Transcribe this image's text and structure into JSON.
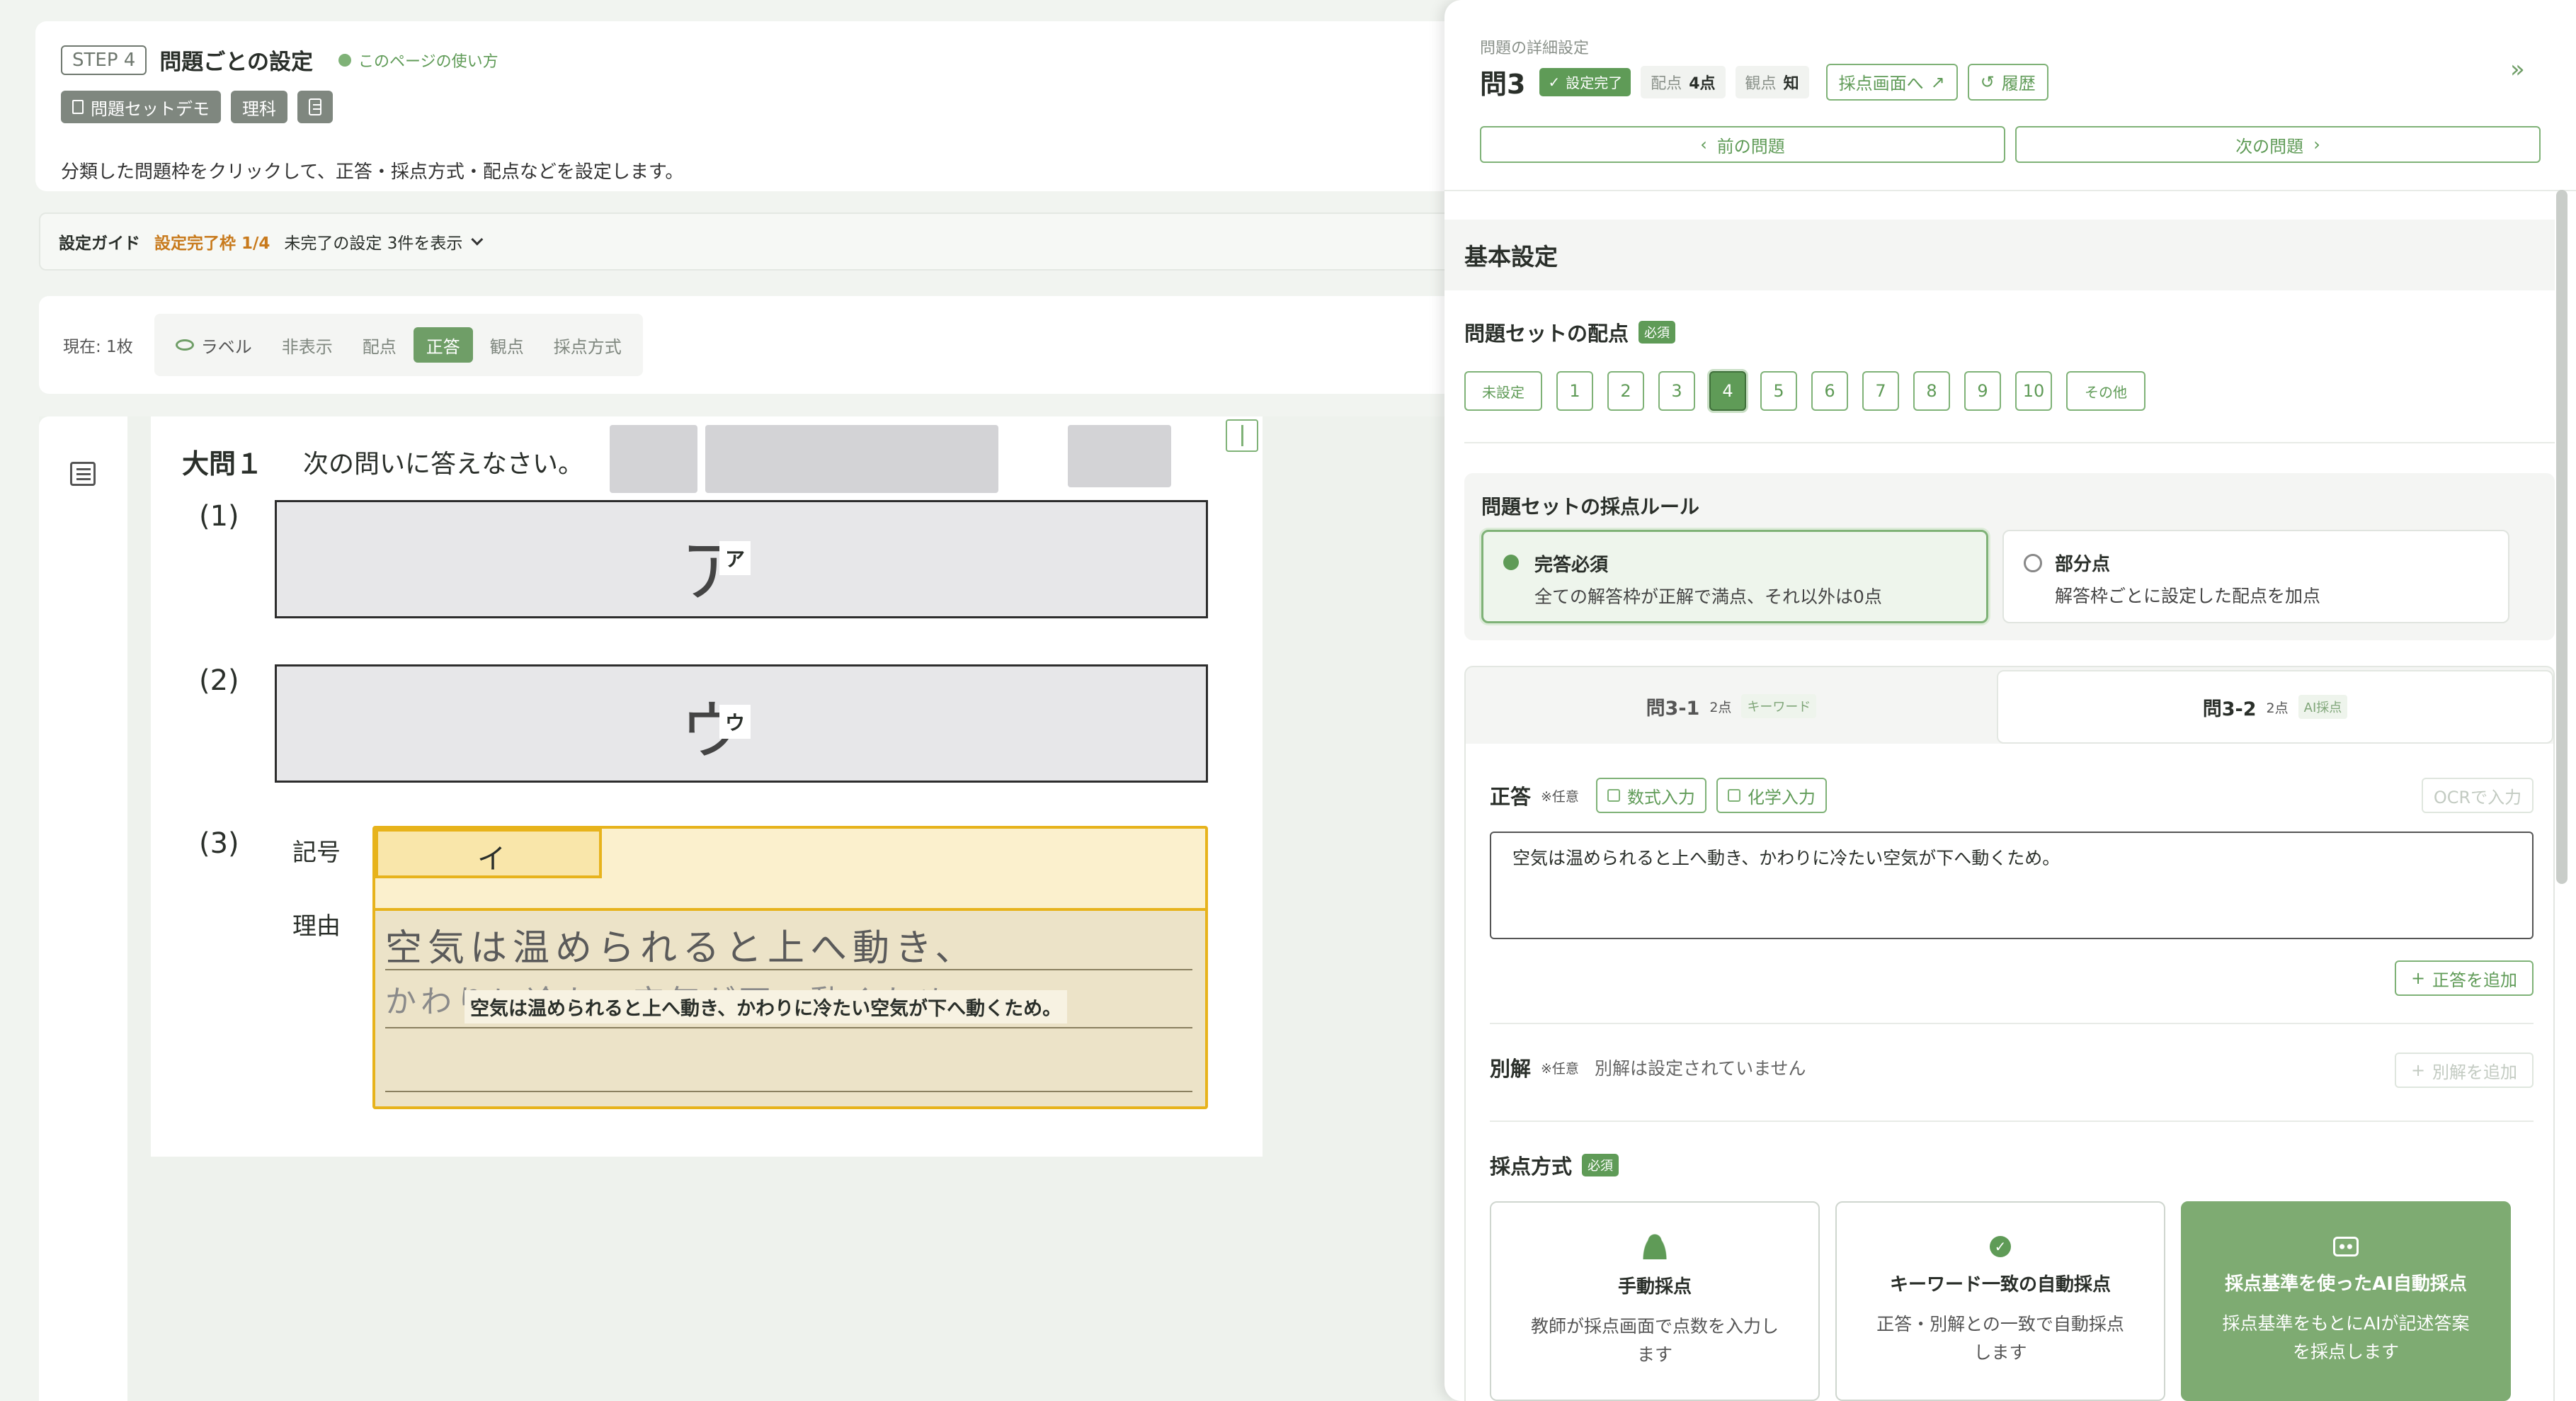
{
  "header": {
    "step_label": "STEP 4",
    "title": "問題ごとの設定",
    "help_link": "このページの使い方",
    "chips": [
      "問題セットデモ",
      "理科"
    ],
    "description": "分類した問題枠をクリックして、正答・採点方式・配点などを設定します。"
  },
  "guide": {
    "title": "設定ガイド",
    "progress": "設定完了枠 1/4",
    "incomplete": "未完了の設定 3件を表示"
  },
  "toolbar": {
    "page_label": "現在: 1枚",
    "tabs": [
      "ラベル",
      "非表示",
      "配点",
      "正答",
      "観点",
      "採点方式"
    ],
    "active_tab": "正答"
  },
  "sheet": {
    "section_no": "大問１",
    "instruction": "次の問いに答えなさい。",
    "q1_label": "(1)",
    "q1_answer": "ア",
    "q1_tag": "ア",
    "q2_label": "(2)",
    "q2_answer": "ウ",
    "q2_tag": "ウ",
    "q3_label": "(3)",
    "symbol_label": "記号",
    "symbol_answer": "イ",
    "reason_label": "理由",
    "reason_line1": "空気は温められると上へ動き、",
    "reason_line2": "かわりに冷たい空気が下へ動くため。",
    "reason_overlay": "空気は温められると上へ動き、かわりに冷たい空気が下へ動くため。"
  },
  "panel": {
    "subtitle": "問題の詳細設定",
    "question": "問3",
    "status": "設定完了",
    "score_label": "配点",
    "score_value": "4点",
    "viewpoint_label": "観点",
    "viewpoint_value": "知",
    "to_grading": "採点画面へ",
    "history": "履歴",
    "prev": "前の問題",
    "next": "次の問題",
    "basic_settings": "基本設定",
    "score_title": "問題セットの配点",
    "required": "必須",
    "score_options": [
      "未設定",
      "1",
      "2",
      "3",
      "4",
      "5",
      "6",
      "7",
      "8",
      "9",
      "10",
      "その他"
    ],
    "score_selected": "4",
    "rule_title": "問題セットの採点ルール",
    "rule_full_title": "完答必須",
    "rule_full_desc": "全ての解答枠が正解で満点、それ以外は0点",
    "rule_partial_title": "部分点",
    "rule_partial_desc": "解答枠ごとに設定した配点を加点",
    "subq_tabs": [
      {
        "label": "問3-1",
        "points": "2点",
        "method": "キーワード"
      },
      {
        "label": "問3-2",
        "points": "2点",
        "method": "AI採点"
      }
    ],
    "answer_title": "正答",
    "optional": "※任意",
    "formula_btn": "数式入力",
    "chem_btn": "化学入力",
    "ocr_btn": "OCRで入力",
    "answer_value": "空気は温められると上へ動き、かわりに冷たい空気が下へ動くため。",
    "add_answer": "正答を追加",
    "alt_title": "別解",
    "alt_empty": "別解は設定されていません",
    "add_alt": "別解を追加",
    "method_title": "採点方式",
    "methods": [
      {
        "title": "手動採点",
        "desc1": "教師が採点画面で点数を入力し",
        "desc2": "ます"
      },
      {
        "title": "キーワード一致の自動採点",
        "desc1": "正答・別解との一致で自動採点",
        "desc2": "します"
      },
      {
        "title": "採点基準を使ったAI自動採点",
        "desc1": "採点基準をもとにAIが記述答案",
        "desc2": "を採点します"
      }
    ]
  }
}
